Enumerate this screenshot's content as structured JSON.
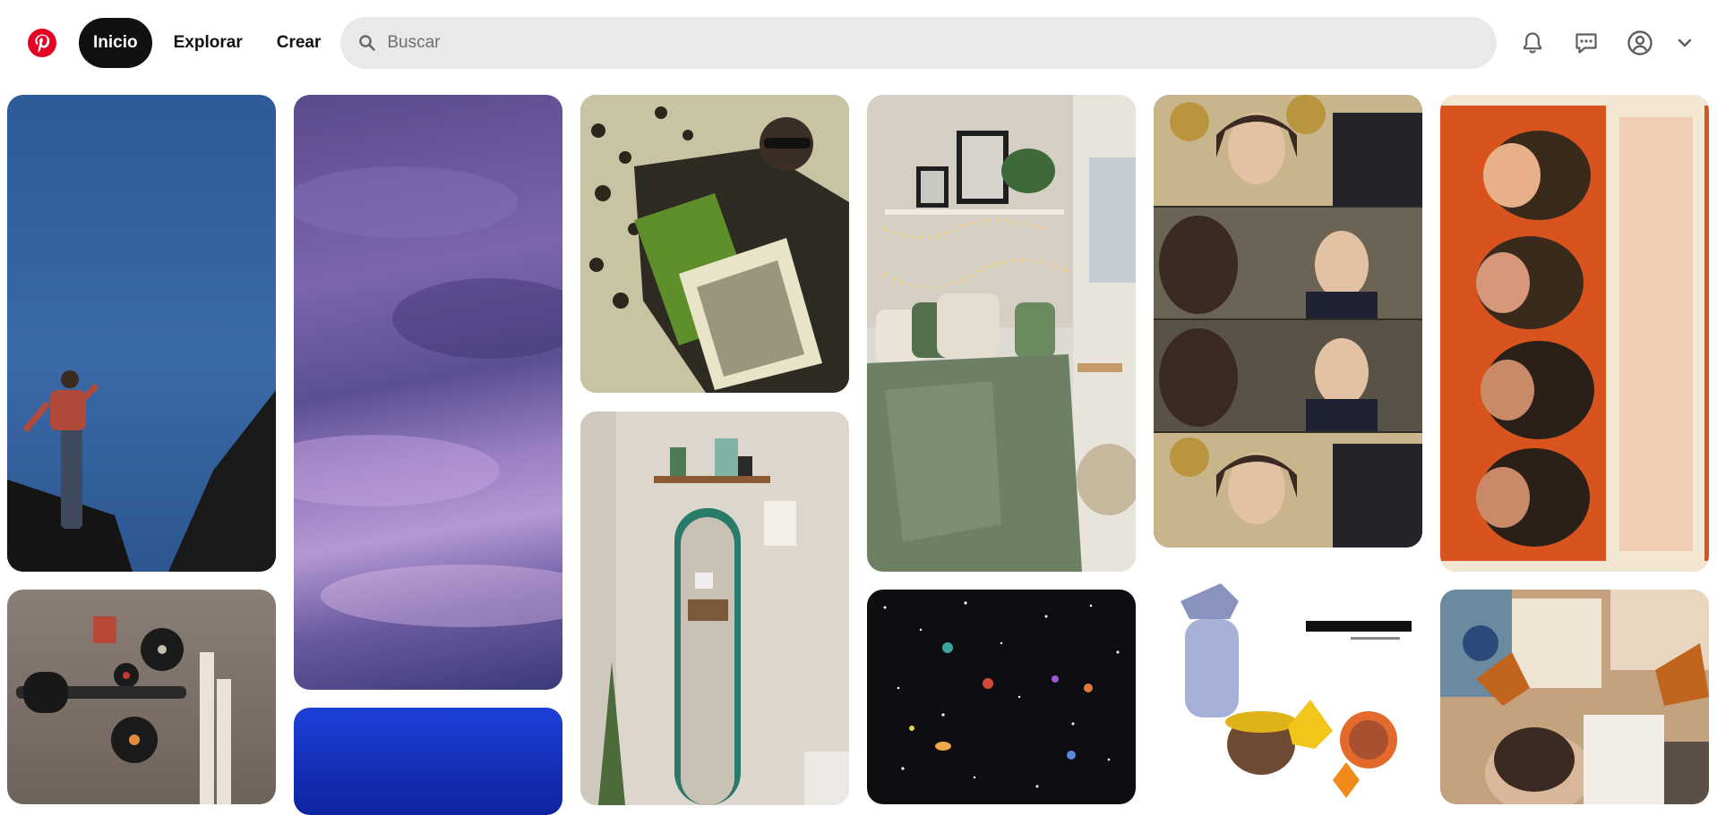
{
  "header": {
    "logo_icon": "pinterest-logo-icon",
    "brand_color": "#e60023",
    "nav": {
      "home_label": "Inicio",
      "explore_label": "Explorar",
      "create_label": "Crear"
    },
    "search": {
      "placeholder": "Buscar",
      "value": "",
      "icon": "search-icon"
    },
    "icons": [
      "notifications-bell-icon",
      "messages-icon",
      "profile-icon",
      "chevron-down-icon"
    ]
  },
  "feed": {
    "pins": [
      {
        "column": 1,
        "subject": "person-balancing-under-blue-sky",
        "palette": [
          "#2f5c99",
          "#1c3f73",
          "#111111"
        ]
      },
      {
        "column": 1,
        "subject": "records-and-guitar-on-wall",
        "palette": [
          "#7a6e66",
          "#4d4038",
          "#222222"
        ]
      },
      {
        "column": 2,
        "subject": "purple-cloudy-sky",
        "palette": [
          "#5b4d8f",
          "#9b7cc6",
          "#3c3a78"
        ]
      },
      {
        "column": 2,
        "subject": "deep-blue-night",
        "palette": [
          "#1b3bd6",
          "#0a1a8a"
        ]
      },
      {
        "column": 3,
        "subject": "man-with-sunglasses-on-leopard-print",
        "palette": [
          "#3a3a2c",
          "#5c8a2a",
          "#c9c3a0"
        ]
      },
      {
        "column": 3,
        "subject": "mirror-and-shelf-in-room",
        "palette": [
          "#d9d3ca",
          "#2f7d6e",
          "#7a5a3a"
        ]
      },
      {
        "column": 4,
        "subject": "green-cozy-bedroom-with-lights",
        "palette": [
          "#cfc7b8",
          "#66785a",
          "#f2d08a"
        ]
      },
      {
        "column": 4,
        "subject": "starry-space-pattern",
        "palette": [
          "#0d0d12",
          "#ffffff",
          "#e07a3b"
        ]
      },
      {
        "column": 5,
        "subject": "period-drama-film-stills",
        "palette": [
          "#3c3a36",
          "#c7a96a",
          "#e3c4aa"
        ]
      },
      {
        "column": 5,
        "subject": "collage-with-yellow-flowers",
        "palette": [
          "#ffffff",
          "#9aa3c9",
          "#f2c51a"
        ]
      },
      {
        "column": 6,
        "subject": "enjambre-band-poster",
        "palette": [
          "#d9531e",
          "#f3e7d3",
          "#3a2a1c"
        ]
      },
      {
        "column": 6,
        "subject": "gilmore-girls-collage",
        "palette": [
          "#c78a4e",
          "#6b8aa0",
          "#e8d6c0"
        ]
      }
    ]
  }
}
